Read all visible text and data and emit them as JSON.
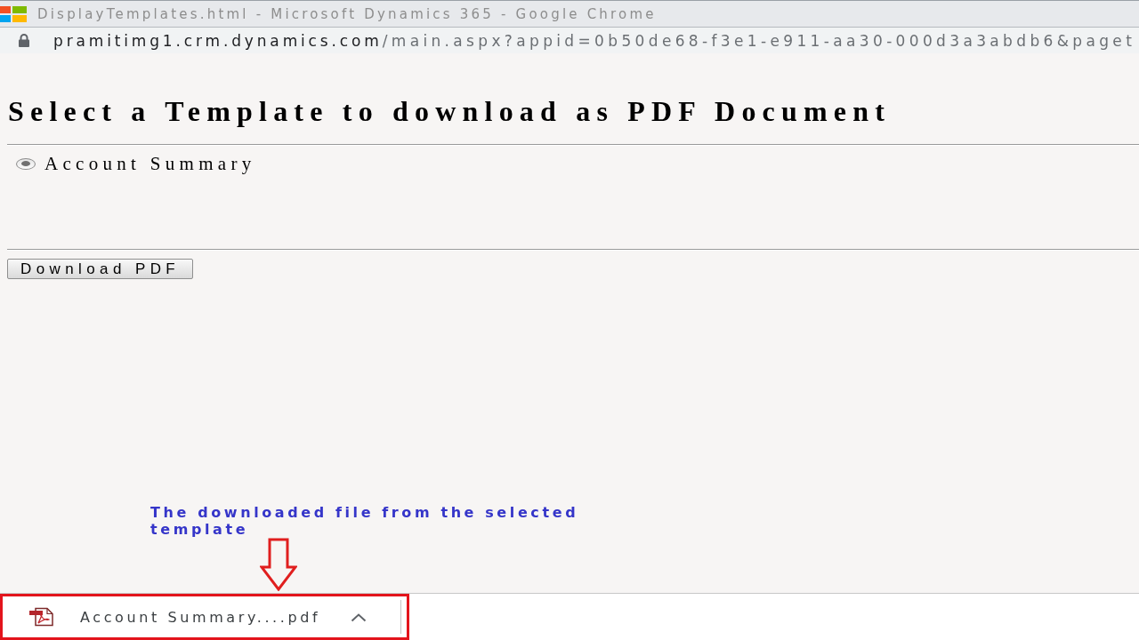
{
  "window": {
    "title": "DisplayTemplates.html - Microsoft Dynamics 365 - Google Chrome"
  },
  "address_bar": {
    "host": "pramitimg1.crm.dynamics.com",
    "path": "/main.aspx?appid=0b50de68-f3e1-e911-aa30-000d3a3abdb6&paget"
  },
  "page": {
    "heading": "Select a Template to download as PDF Document",
    "templates": [
      {
        "label": "Account Summary",
        "selected": true
      }
    ],
    "button": "Download PDF"
  },
  "annotation": {
    "text": "The downloaded file from the selected template"
  },
  "download_bar": {
    "items": [
      {
        "filename": "Account Summary....pdf"
      }
    ]
  }
}
